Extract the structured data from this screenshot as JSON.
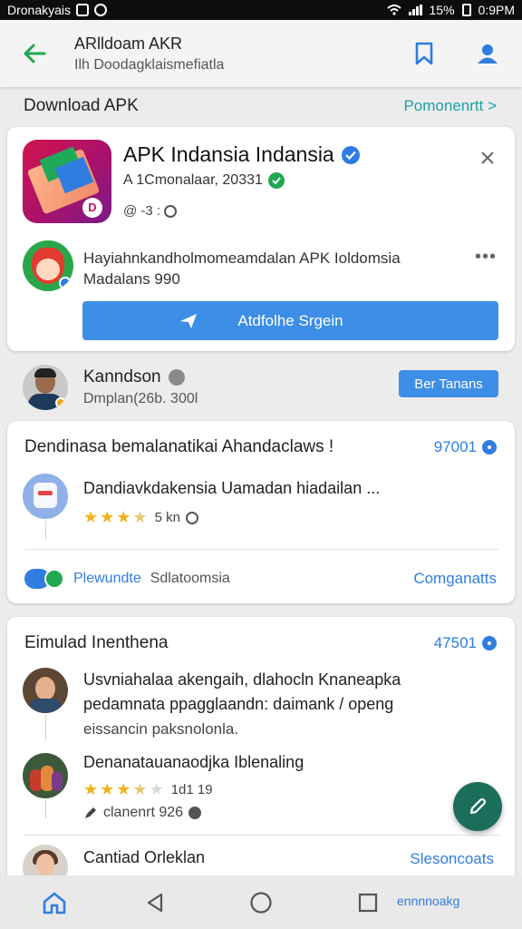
{
  "status_bar": {
    "left_text": "Dronakyais",
    "battery": "15%",
    "time": "0:9PM"
  },
  "app_bar": {
    "title": "ARlldoam AKR",
    "subtitle": "Ilh Doodagklaismefiatla"
  },
  "section": {
    "title": "Download APK",
    "link": "Pomonenrtt >"
  },
  "app_card": {
    "name": "APK Indansia Indansia",
    "meta": "A 1Cmonalaar, 20331",
    "stat": "@ -3 :",
    "post_text_line1": "Hayiahnkandholmomeamdalan APK Ioldomsia",
    "post_text_line2": "Madalans 990",
    "more": "•••",
    "button_label": "Atdfolhe Srgein"
  },
  "user": {
    "name": "Kanndson",
    "sub": "Dmplan(26b. 300l",
    "button": "Ber Tanans"
  },
  "list1": {
    "title": "Dendinasa bemalanatikai Ahandaclaws !",
    "count": "97001",
    "item": {
      "title": "Dandiavkdakensia Uamadan hiadailan ...",
      "rating_text": "5 kn"
    },
    "foot_text_a": "Plewundte",
    "foot_text_b": "Sdlatoomsia",
    "foot_link": "Comganatts"
  },
  "list2": {
    "title": "Eimulad Inenthena",
    "count": "47501",
    "item1": {
      "line1": "Usvniahalaa akengaih, dlahocln Knaneapka",
      "line2": "pedamnata ppagglaandn: daimank / openg",
      "line3": "eissancin paksnolonla."
    },
    "item2": {
      "title": "Denanatauanaodjka Iblenaling",
      "rating_text": "1d1 19",
      "meta": "clanenrt 926"
    },
    "item3": {
      "title": "Cantiad Orleklan",
      "link": "Slesoncoats"
    }
  },
  "nav": {
    "label": "ennnnoakg"
  },
  "colors": {
    "accent": "#3d8ee6",
    "link": "#2f7de0",
    "teal_link": "#1aa0a8",
    "back_arrow": "#1fa84f",
    "fab": "#1b6e5a"
  }
}
